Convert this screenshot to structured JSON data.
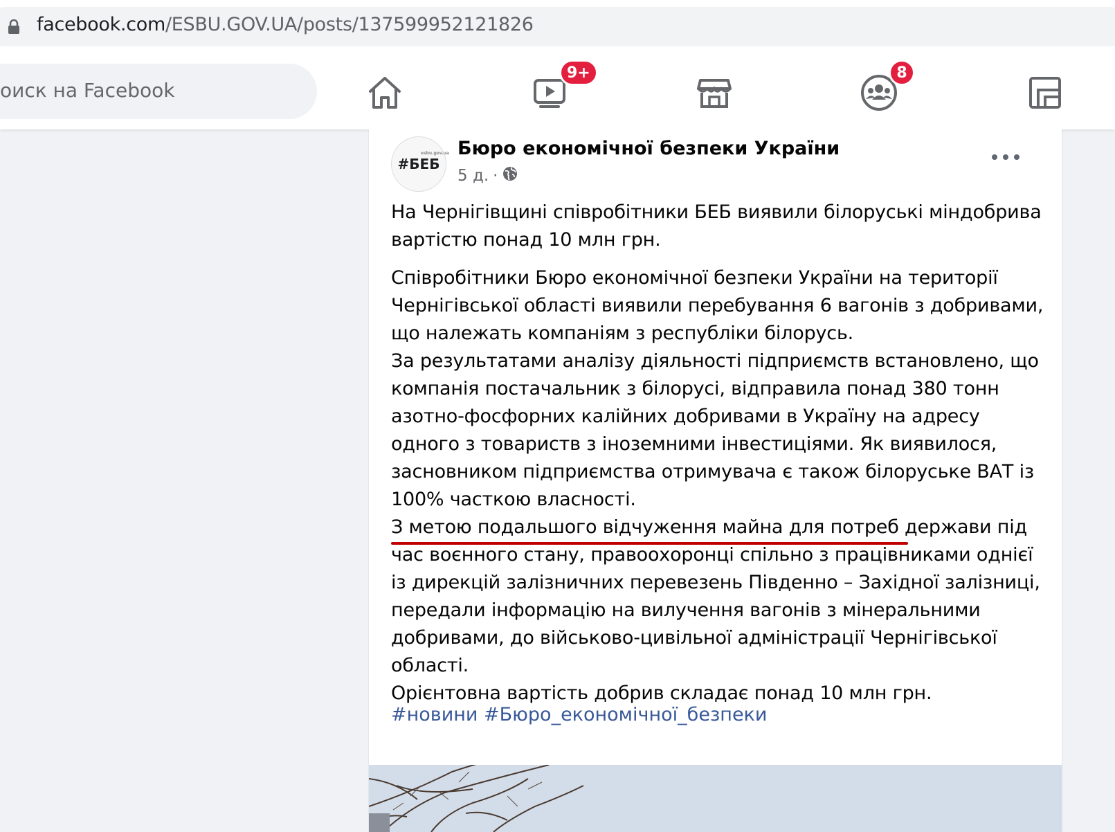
{
  "browser": {
    "url_host": "facebook.com",
    "url_path": "/ESBU.GOV.UA/posts/137599952121826"
  },
  "topnav": {
    "search_placeholder": "оиск на Facebook",
    "watch_badge": "9+",
    "groups_badge": "8"
  },
  "post": {
    "avatar_text": "#БЕБ",
    "avatar_small_text": "esbu.gov.ua",
    "page_name": "Бюро економічної безпеки України",
    "time": "5 д.",
    "meta_separator": "·",
    "headline": "На Чернігівщині співробітники БЕБ виявили білоруські міндобрива\nвартістю понад 10 млн грн.",
    "body": "Співробітники Бюро економічної безпеки України на території\nЧернігівської області виявили перебування 6 вагонів з добривами,\nщо належать компаніям з республіки білорусь.\nЗа результатами аналізу діяльності підприємств встановлено, що\nкомпанія постачальник з білорусі, відправила понад 380 тонн\nазотно-фосфорних калійних добривами в Україну на адресу\nодного з товариств з іноземними інвестиціями. Як виявилося,\nзасновником підприємства отримувача є також білоруське ВАТ із\n100% часткою власності.\nЗ метою подальшого відчуження майна для потреб держави під\nчас воєнного стану, правоохоронці спільно з працівниками однієї\nіз дирекцій залізничних перевезень Південно – Західної залізниці,\nпередали інформацію на вилучення вагонів з мінеральними\nдобривами, до військово-цивільної адміністрації Чернігівської\nобласті.\nОрієнтовна вартість добрив складає понад 10 млн грн.",
    "hashtags": "#новини #Бюро_економічної_безпеки",
    "highlight_color": "#c00000"
  }
}
